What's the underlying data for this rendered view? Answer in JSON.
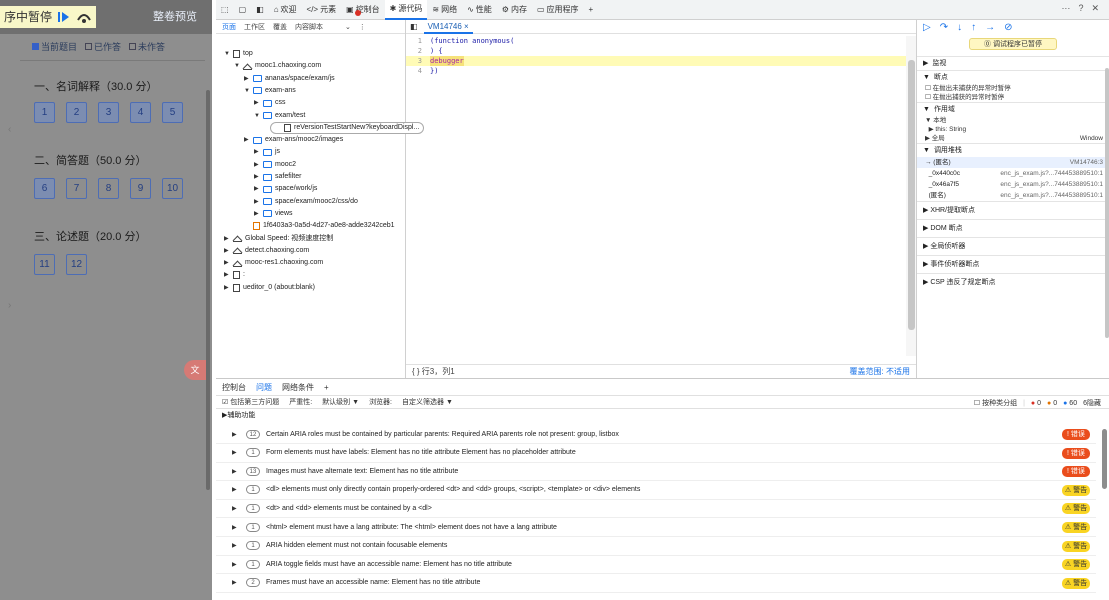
{
  "left_panel": {
    "paused_label": "序中暂停",
    "preview_button": "整卷预览",
    "legend": [
      "当前题目",
      "已作答",
      "未作答"
    ],
    "sections": [
      {
        "title": "一、名词解释（30.0 分）",
        "items": [
          "1",
          "2",
          "3",
          "4",
          "5"
        ]
      },
      {
        "title": "二、简答题（50.0 分）",
        "items": [
          "6",
          "7",
          "8",
          "9",
          "10"
        ]
      },
      {
        "title": "三、论述题（20.0 分）",
        "items": [
          "11",
          "12"
        ]
      }
    ],
    "fab_label": "文"
  },
  "devtools": {
    "tabs": [
      "欢迎",
      "元素",
      "控制台",
      "源代码",
      "网络",
      "性能",
      "内存",
      "应用程序"
    ],
    "active_tab": "源代码",
    "top_right": [
      "···",
      "?",
      "✕"
    ],
    "navigator_tabs": [
      "页面",
      "工作区",
      "覆盖",
      "内容脚本"
    ],
    "tree": [
      {
        "label": "top",
        "depth": 0,
        "kind": "page",
        "arrow": "▼"
      },
      {
        "label": "mooc1.chaoxing.com",
        "depth": 1,
        "kind": "cloud",
        "arrow": "▼"
      },
      {
        "label": "ananas/space/exam/js",
        "depth": 2,
        "kind": "folder",
        "arrow": "▶"
      },
      {
        "label": "exam-ans",
        "depth": 2,
        "kind": "folder",
        "arrow": "▼"
      },
      {
        "label": "css",
        "depth": 3,
        "kind": "folder",
        "arrow": "▶"
      },
      {
        "label": "exam/test",
        "depth": 3,
        "kind": "folder",
        "arrow": "▼"
      },
      {
        "label": "reVersionTestStartNew?keyboardDispl...",
        "depth": 4,
        "kind": "file",
        "arrow": "",
        "selected": true
      },
      {
        "label": "exam-ans/mooc2/images",
        "depth": 2,
        "kind": "folder",
        "arrow": "▶"
      },
      {
        "label": "js",
        "depth": 3,
        "kind": "folder",
        "arrow": "▶"
      },
      {
        "label": "mooc2",
        "depth": 3,
        "kind": "folder",
        "arrow": "▶"
      },
      {
        "label": "safefilter",
        "depth": 3,
        "kind": "folder",
        "arrow": "▶"
      },
      {
        "label": "space/work/js",
        "depth": 3,
        "kind": "folder",
        "arrow": "▶"
      },
      {
        "label": "space/exam/mooc2/css/do",
        "depth": 3,
        "kind": "folder",
        "arrow": "▶"
      },
      {
        "label": "views",
        "depth": 3,
        "kind": "folder",
        "arrow": "▶"
      },
      {
        "label": "1f6403a3-0a5d-4d27-a0e8-adde3242ceb1",
        "depth": 2,
        "kind": "file-orange",
        "arrow": ""
      },
      {
        "label": "Global Speed: 视频速度控制",
        "depth": 0,
        "kind": "cloud",
        "arrow": "▶"
      },
      {
        "label": "detect.chaoxing.com",
        "depth": 0,
        "kind": "cloud",
        "arrow": "▶"
      },
      {
        "label": "mooc-res1.chaoxing.com",
        "depth": 0,
        "kind": "cloud",
        "arrow": "▶"
      },
      {
        "label": ":",
        "depth": 0,
        "kind": "page",
        "arrow": "▶"
      },
      {
        "label": "ueditor_0 (about:blank)",
        "depth": 0,
        "kind": "page",
        "arrow": "▶"
      }
    ],
    "editor": {
      "file_tab": "VM14746",
      "lines": [
        {
          "n": "1",
          "text": "(function anonymous("
        },
        {
          "n": "2",
          "text": ") {"
        },
        {
          "n": "3",
          "text": "debugger",
          "highlight": true
        },
        {
          "n": "4",
          "text": "})"
        }
      ],
      "status_left": "{ }  行3，列1",
      "status_right": "覆盖范围: 不适用"
    },
    "debugger": {
      "paused_text": "⓪ 调试程序已暂停",
      "watch": "监视",
      "breakpoints": "断点",
      "bp_options": [
        "在抛出未捕获的异常时暂停",
        "在抛出捕获的异常时暂停"
      ],
      "scope": "作用域",
      "scope_items": [
        {
          "name": "▼ 本地",
          "val": ""
        },
        {
          "name": "  ▶ this: String",
          "val": ""
        },
        {
          "name": "▶ 全局",
          "val": "Window"
        }
      ],
      "callstack": "调用堆栈",
      "frames": [
        {
          "name": "(匿名)",
          "file": "VM14746:3"
        },
        {
          "name": "_0x440c0c",
          "file": "enc_js_exam.js?...744453889510:1"
        },
        {
          "name": "_0x46a7f5",
          "file": "enc_js_exam.js?...744453889510:1"
        },
        {
          "name": "(匿名)",
          "file": "enc_js_exam.js?...744453889510:1"
        }
      ],
      "more": [
        "XHR/提取断点",
        "DOM 断点",
        "全局侦听器",
        "事件侦听器断点",
        "CSP 违反了规定断点"
      ]
    },
    "drawer": {
      "tabs": [
        "控制台",
        "问题",
        "网络条件"
      ],
      "active": "问题",
      "filters": [
        "包括第三方问题",
        "严重性:",
        "默认级别 ▼",
        "浏览器:",
        "自定义筛选器 ▼"
      ],
      "group_label": "按种类分组",
      "counts": [
        "0",
        "0",
        "60",
        "6隐藏"
      ],
      "category": "▶辅助功能",
      "issues": [
        {
          "count": "12",
          "text": "Certain ARIA roles must be contained by particular parents: Required ARIA parents role not present: group, listbox",
          "level": "err"
        },
        {
          "count": "1",
          "text": "Form elements must have labels: Element has no title attribute Element has no placeholder attribute",
          "level": "err"
        },
        {
          "count": "13",
          "text": "Images must have alternate text: Element has no title attribute",
          "level": "err"
        },
        {
          "count": "1",
          "text": "<dl> elements must only directly contain properly-ordered <dt> and <dd> groups, <script>, <template> or <div> elements",
          "level": "warn"
        },
        {
          "count": "1",
          "text": "<dt> and <dd> elements must be contained by a <dl>",
          "level": "warn"
        },
        {
          "count": "1",
          "text": "<html> element must have a lang attribute: The <html> element does not have a lang attribute",
          "level": "warn"
        },
        {
          "count": "1",
          "text": "ARIA hidden element must not contain focusable elements",
          "level": "warn"
        },
        {
          "count": "1",
          "text": "ARIA toggle fields must have an accessible name: Element has no title attribute",
          "level": "warn"
        },
        {
          "count": "2",
          "text": "Frames must have an accessible name: Element has no title attribute",
          "level": "warn"
        }
      ],
      "err_label": "! 错误",
      "warn_label": "⚠ 警告"
    }
  }
}
